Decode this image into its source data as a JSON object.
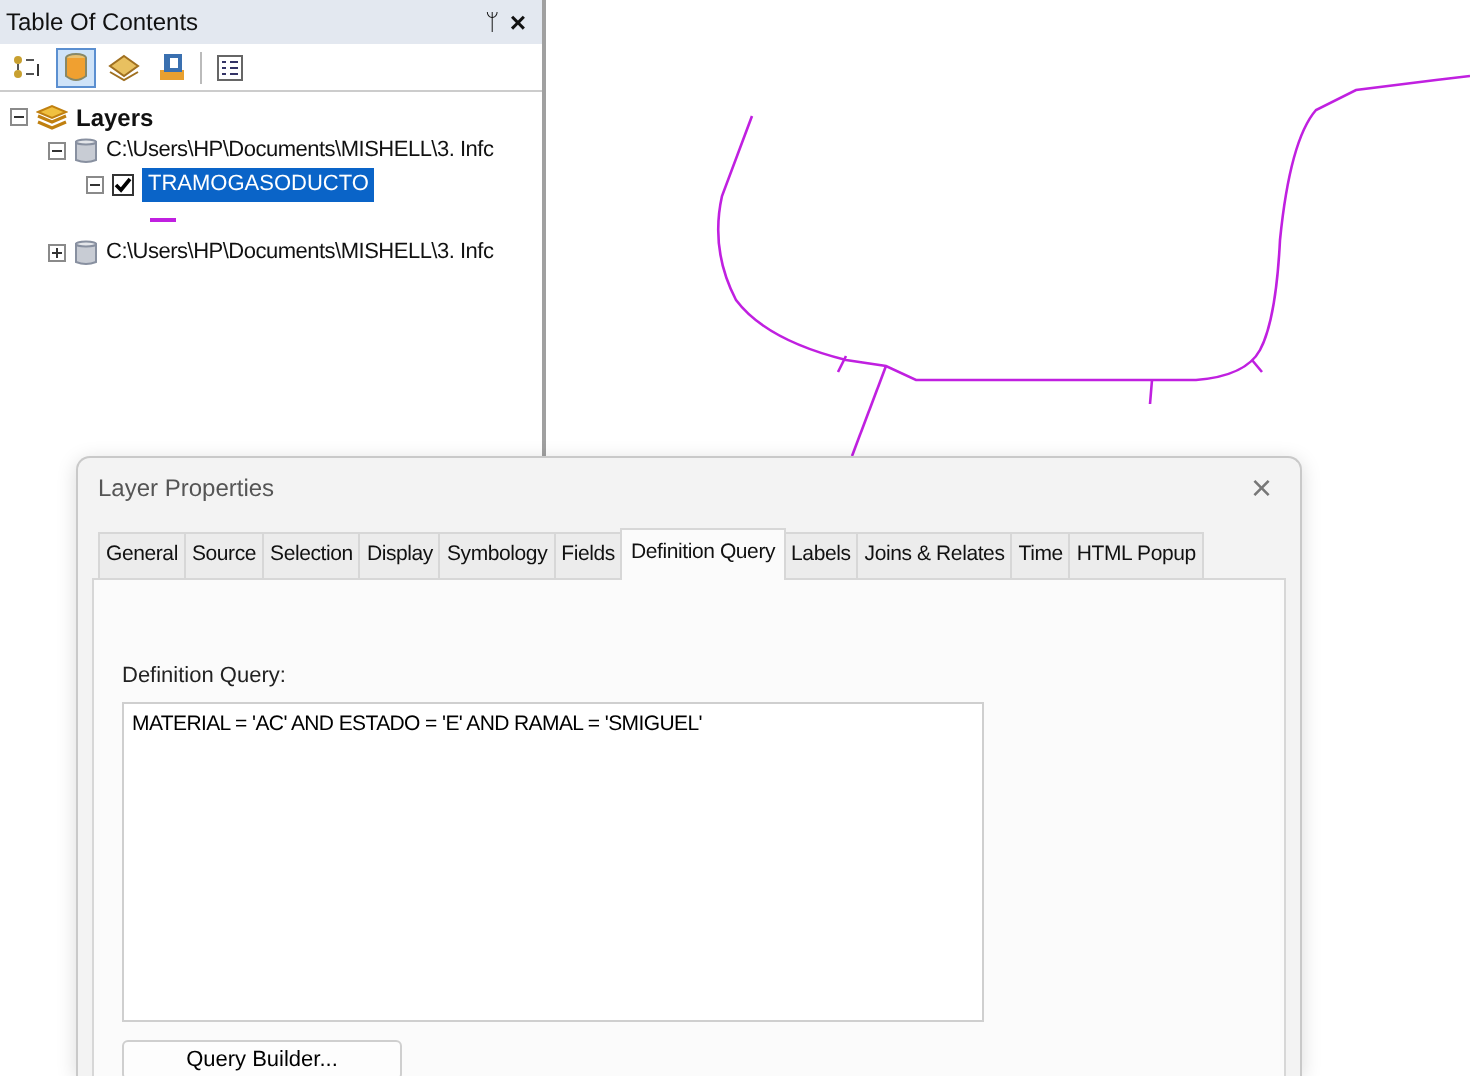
{
  "toc": {
    "title": "Table Of Contents",
    "pin": "ᛘ",
    "close": "×",
    "tree": [
      {
        "label": "Layers",
        "kind": "frame",
        "expanded": true,
        "children": [
          {
            "label": "C:\\Users\\HP\\Documents\\MISHELL\\3. Infc",
            "kind": "source",
            "expanded": true,
            "children": [
              {
                "label": "TRAMOGASODUCTO",
                "kind": "layer",
                "expanded": true,
                "checked": true,
                "selected": true
              }
            ]
          },
          {
            "label": "C:\\Users\\HP\\Documents\\MISHELL\\3. Infc",
            "kind": "source",
            "expanded": false
          }
        ]
      }
    ]
  },
  "dialog": {
    "title": "Layer Properties",
    "close": "×",
    "tabs": [
      {
        "label": "General",
        "selected": false
      },
      {
        "label": "Source",
        "selected": false
      },
      {
        "label": "Selection",
        "selected": false
      },
      {
        "label": "Display",
        "selected": false
      },
      {
        "label": "Symbology",
        "selected": false
      },
      {
        "label": "Fields",
        "selected": false
      },
      {
        "label": "Definition Query",
        "selected": true
      },
      {
        "label": "Labels",
        "selected": false
      },
      {
        "label": "Joins & Relates",
        "selected": false
      },
      {
        "label": "Time",
        "selected": false
      },
      {
        "label": "HTML Popup",
        "selected": false
      }
    ],
    "query_label": "Definition Query:",
    "query": "MATERIAL = 'AC' AND ESTADO = 'E' AND RAMAL = 'SMIGUEL'",
    "button": "Query Builder..."
  }
}
